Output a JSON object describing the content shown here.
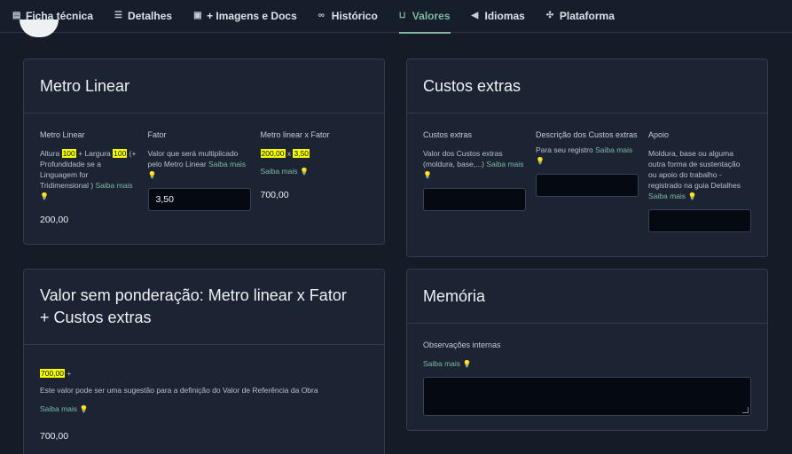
{
  "tabs": [
    {
      "label": "Ficha técnica",
      "icon": "datasheet-icon"
    },
    {
      "label": "Detalhes",
      "icon": "details-icon"
    },
    {
      "label": "+ Imagens e Docs",
      "icon": "images-icon"
    },
    {
      "label": "Histórico",
      "icon": "binoculars-icon"
    },
    {
      "label": "Valores",
      "icon": "cart-icon",
      "active": true
    },
    {
      "label": "Idiomas",
      "icon": "megaphone-icon"
    },
    {
      "label": "Plataforma",
      "icon": "platform-icon"
    }
  ],
  "metro_linear": {
    "title": "Metro Linear",
    "col1": {
      "label": "Metro Linear",
      "d_a": "Altura ",
      "hl1": "100",
      "d_b": " + Largura ",
      "hl2": "100",
      "d_c": " (+ Profundidade se a Linguagem for Tridimensional ) ",
      "link": "Saiba mais",
      "value": "200,00"
    },
    "col2": {
      "label": "Fator",
      "desc": "Valor que será multiplicado pelo Metro Linear ",
      "link": "Saiba mais",
      "input_value": "3,50"
    },
    "col3": {
      "label": "Metro linear x Fator",
      "hl1": "200,00",
      "op": " x ",
      "hl2": "3,50",
      "link": "Saiba mais",
      "value": "700,00"
    }
  },
  "custos_extras": {
    "title": "Custos extras",
    "col1": {
      "label": "Custos extras",
      "desc": "Valor dos Custos extras (moldura, base,...) ",
      "link": "Saiba mais",
      "input_value": ""
    },
    "col2": {
      "label": "Descrição dos Custos extras",
      "desc": "Para seu registro ",
      "link": "Saiba mais",
      "input_value": ""
    },
    "col3": {
      "label": "Apoio",
      "desc": "Moldura, base ou alguma outra forma de sustentação ou apoio do trabalho - registrado na guia Detalhes ",
      "link": "Saiba mais",
      "input_value": ""
    }
  },
  "valor_sem_ponderacao": {
    "title": "Valor sem ponderação: Metro linear x Fator + Custos extras",
    "hl": "700,00",
    "plus": " +",
    "desc": "Este valor pode ser uma sugestão para a definição do Valor de Referência da Obra",
    "link": "Saiba mais",
    "value": "700,00"
  },
  "memoria": {
    "title": "Memória",
    "label": "Observações internas",
    "link": "Saiba mais",
    "textarea_value": ""
  },
  "colors": {
    "accent": "#7fb7a2",
    "highlight": "#f6ff00",
    "card_bg": "#1c2433",
    "page_bg": "#151b27"
  }
}
